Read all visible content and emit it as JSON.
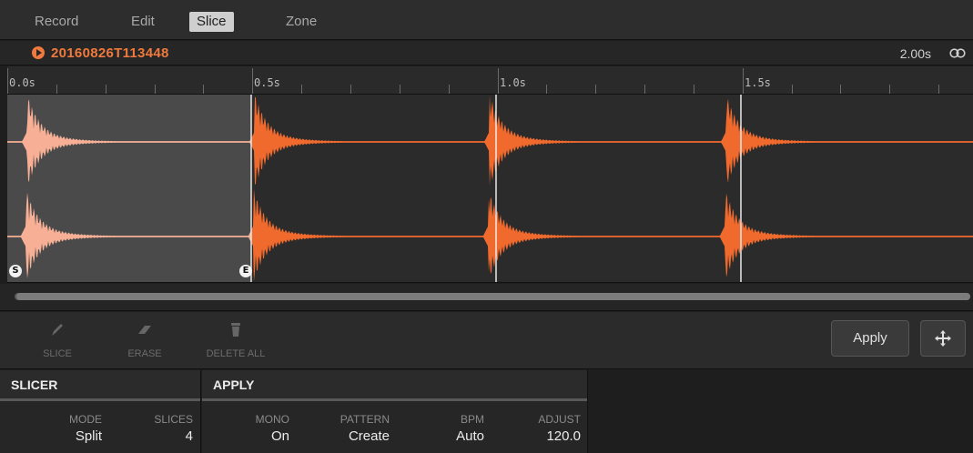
{
  "tabs": [
    {
      "label": "Record"
    },
    {
      "label": "Edit"
    },
    {
      "label": "Slice",
      "active": true
    },
    {
      "label": "Zone"
    }
  ],
  "sample": {
    "name": "20160826T113448",
    "length": "2.00s"
  },
  "ruler": {
    "labels": [
      "0.0s",
      "0.5s",
      "1.0s",
      "1.5s"
    ]
  },
  "waveform": {
    "slice_start_marker": "S",
    "slice_end_marker": "E",
    "colors": {
      "selected": "#f7b096",
      "wave": "#f06a2e",
      "background": "#2b2b2b"
    }
  },
  "tools": {
    "slice": "SLICE",
    "erase": "ERASE",
    "delete_all": "DELETE ALL",
    "apply": "Apply"
  },
  "slicer": {
    "title": "SLICER",
    "mode_label": "MODE",
    "mode_value": "Split",
    "slices_label": "SLICES",
    "slices_value": "4"
  },
  "apply": {
    "title": "APPLY",
    "mono_label": "MONO",
    "mono_value": "On",
    "pattern_label": "PATTERN",
    "pattern_value": "Create",
    "bpm_label": "BPM",
    "bpm_value": "Auto",
    "adjust_label": "ADJUST",
    "adjust_value": "120.0"
  }
}
